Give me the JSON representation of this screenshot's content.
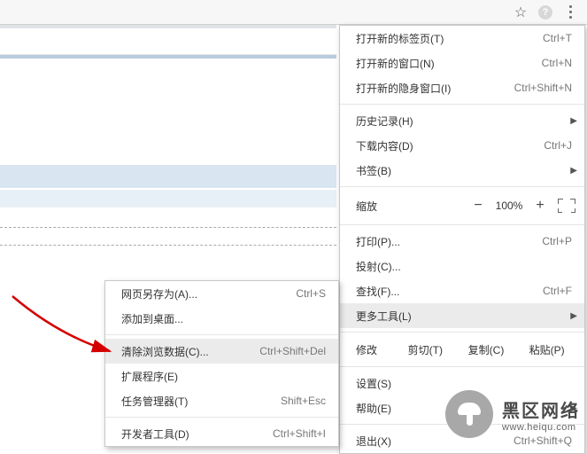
{
  "toolbar": {
    "star": "☆"
  },
  "main_menu": {
    "new_tab": {
      "label": "打开新的标签页(T)",
      "shortcut": "Ctrl+T"
    },
    "new_window": {
      "label": "打开新的窗口(N)",
      "shortcut": "Ctrl+N"
    },
    "incognito": {
      "label": "打开新的隐身窗口(I)",
      "shortcut": "Ctrl+Shift+N"
    },
    "history": {
      "label": "历史记录(H)"
    },
    "downloads": {
      "label": "下载内容(D)",
      "shortcut": "Ctrl+J"
    },
    "bookmarks": {
      "label": "书签(B)"
    },
    "zoom": {
      "label": "缩放",
      "value": "100%",
      "minus": "−",
      "plus": "+"
    },
    "print": {
      "label": "打印(P)...",
      "shortcut": "Ctrl+P"
    },
    "cast": {
      "label": "投射(C)..."
    },
    "find": {
      "label": "查找(F)...",
      "shortcut": "Ctrl+F"
    },
    "more_tools": {
      "label": "更多工具(L)"
    },
    "edit": {
      "label": "修改",
      "cut": "剪切(T)",
      "copy": "复制(C)",
      "paste": "粘贴(P)"
    },
    "settings": {
      "label": "设置(S)"
    },
    "help": {
      "label": "帮助(E)"
    },
    "exit": {
      "label": "退出(X)",
      "shortcut": "Ctrl+Shift+Q"
    }
  },
  "sub_menu": {
    "save_as": {
      "label": "网页另存为(A)...",
      "shortcut": "Ctrl+S"
    },
    "add_desktop": {
      "label": "添加到桌面..."
    },
    "clear_data": {
      "label": "清除浏览数据(C)...",
      "shortcut": "Ctrl+Shift+Del"
    },
    "extensions": {
      "label": "扩展程序(E)"
    },
    "task_manager": {
      "label": "任务管理器(T)",
      "shortcut": "Shift+Esc"
    },
    "dev_tools": {
      "label": "开发者工具(D)",
      "shortcut": "Ctrl+Shift+I"
    }
  },
  "watermark": {
    "cn": "黑区网络",
    "url": "www.heiqu.com"
  }
}
